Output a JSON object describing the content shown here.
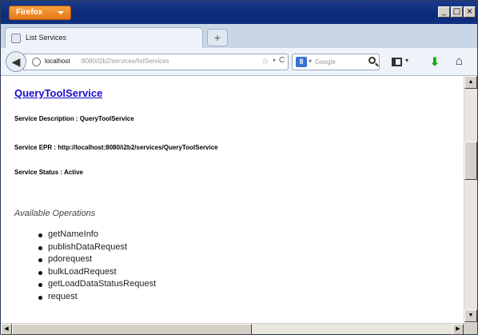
{
  "browser": {
    "menu_button_label": "Firefox",
    "window_controls": {
      "minimize": "_",
      "maximize": "□",
      "close": "×"
    }
  },
  "tabs": [
    {
      "label": "List Services",
      "active": true
    }
  ],
  "new_tab_label": "+",
  "navbar": {
    "url_host": "localhost",
    "url_path": ":8080/i2b2/services/listServices",
    "search_placeholder": "Google",
    "search_engine_letter": "8"
  },
  "page": {
    "service_name": "QueryToolService",
    "description_line": "Service Description : QueryToolService",
    "epr_line": "Service EPR : http://localhost:8080/i2b2/services/QueryToolService",
    "status_line": "Service Status : Active",
    "operations_title": "Available Operations",
    "operations": [
      "getNameInfo",
      "publishDataRequest",
      "pdorequest",
      "bulkLoadRequest",
      "getLoadDataStatusRequest",
      "request"
    ]
  },
  "colors": {
    "titlebar": "#0c2a78",
    "firefox_button": "#e5761a",
    "link": "#1a0dcc",
    "download_arrow": "#1aa51a"
  }
}
